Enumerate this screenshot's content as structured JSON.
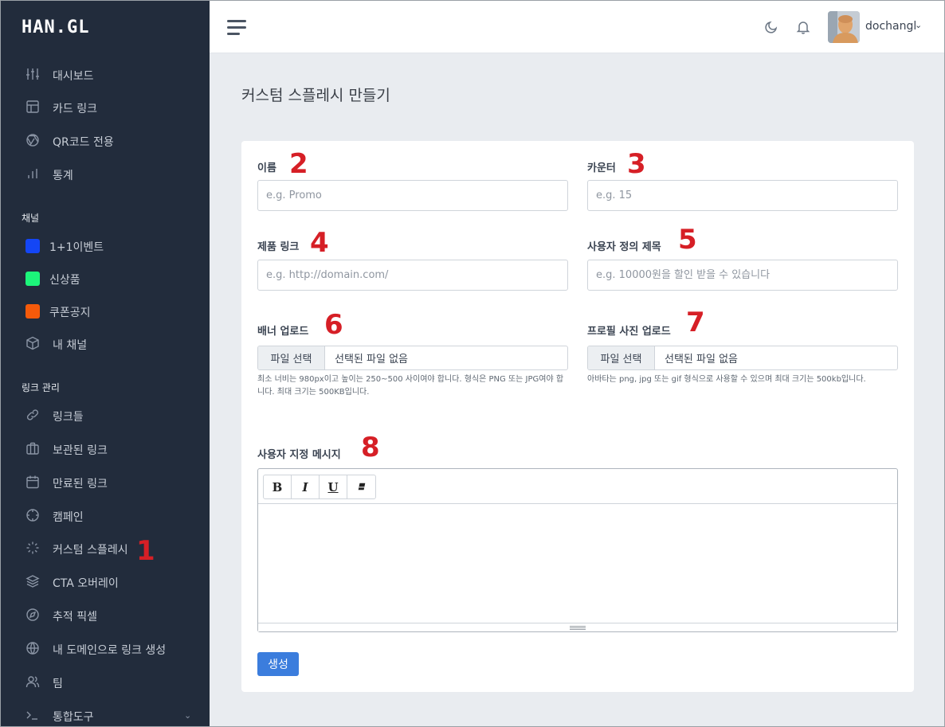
{
  "app": {
    "logo": "HAN.GL"
  },
  "sidebar": {
    "items": [
      {
        "label": "대시보드",
        "icon": "sliders-icon"
      },
      {
        "label": "카드 링크",
        "icon": "layout-icon"
      },
      {
        "label": "QR코드 전용",
        "icon": "aperture-icon"
      },
      {
        "label": "통계",
        "icon": "bar-chart-icon"
      }
    ],
    "channels_title": "채널",
    "channels": [
      {
        "label": "1+1이벤트",
        "color": "#1446f5"
      },
      {
        "label": "신상품",
        "color": "#1cf57a"
      },
      {
        "label": "쿠폰공지",
        "color": "#f55a0a"
      },
      {
        "label": "내 채널",
        "icon": "box-icon"
      }
    ],
    "links_title": "링크 관리",
    "links": [
      {
        "label": "링크들",
        "icon": "link-icon"
      },
      {
        "label": "보관된 링크",
        "icon": "briefcase-icon"
      },
      {
        "label": "만료된 링크",
        "icon": "calendar-icon"
      },
      {
        "label": "캠페인",
        "icon": "crosshair-icon"
      },
      {
        "label": "커스텀 스플레시",
        "icon": "loader-icon"
      },
      {
        "label": "CTA 오버레이",
        "icon": "layers-icon"
      },
      {
        "label": "추적 픽셀",
        "icon": "compass-icon"
      },
      {
        "label": "내 도메인으로 링크 생성",
        "icon": "globe-icon"
      },
      {
        "label": "팀",
        "icon": "users-icon"
      },
      {
        "label": "통합도구",
        "icon": "terminal-icon"
      }
    ]
  },
  "topbar": {
    "username": "dochangl"
  },
  "page": {
    "title": "커스텀 스플레시 만들기"
  },
  "form": {
    "name": {
      "label": "이름",
      "placeholder": "e.g. Promo"
    },
    "counter": {
      "label": "카운터",
      "placeholder": "e.g. 15"
    },
    "product_link": {
      "label": "제품 링크",
      "placeholder": "e.g. http://domain.com/"
    },
    "custom_title": {
      "label": "사용자 정의 제목",
      "placeholder": "e.g. 10000원을 할인 받을 수 있습니다"
    },
    "banner": {
      "label": "배너 업로드",
      "button": "파일 선택",
      "status": "선택된 파일 없음",
      "help": "최소 너비는 980px이고 높이는 250~500 사이여야 합니다. 형식은 PNG 또는 JPG여야 합니다. 최대 크기는 500KB입니다."
    },
    "avatar": {
      "label": "프로필 사진 업로드",
      "button": "파일 선택",
      "status": "선택된 파일 없음",
      "help": "아바타는 png, jpg 또는 gif 형식으로 사용할 수 있으며 최대 크기는 500kb입니다."
    },
    "message": {
      "label": "사용자 지정 메시지"
    },
    "toolbar": {
      "bold": "B",
      "italic": "I",
      "underline": "U"
    },
    "submit": "생성"
  },
  "annotations": [
    "1",
    "2",
    "3",
    "4",
    "5",
    "6",
    "7",
    "8"
  ],
  "colors": {
    "sidebar_bg": "#222c3c",
    "accent": "#3b7ddd",
    "annotation": "#d61f26"
  }
}
